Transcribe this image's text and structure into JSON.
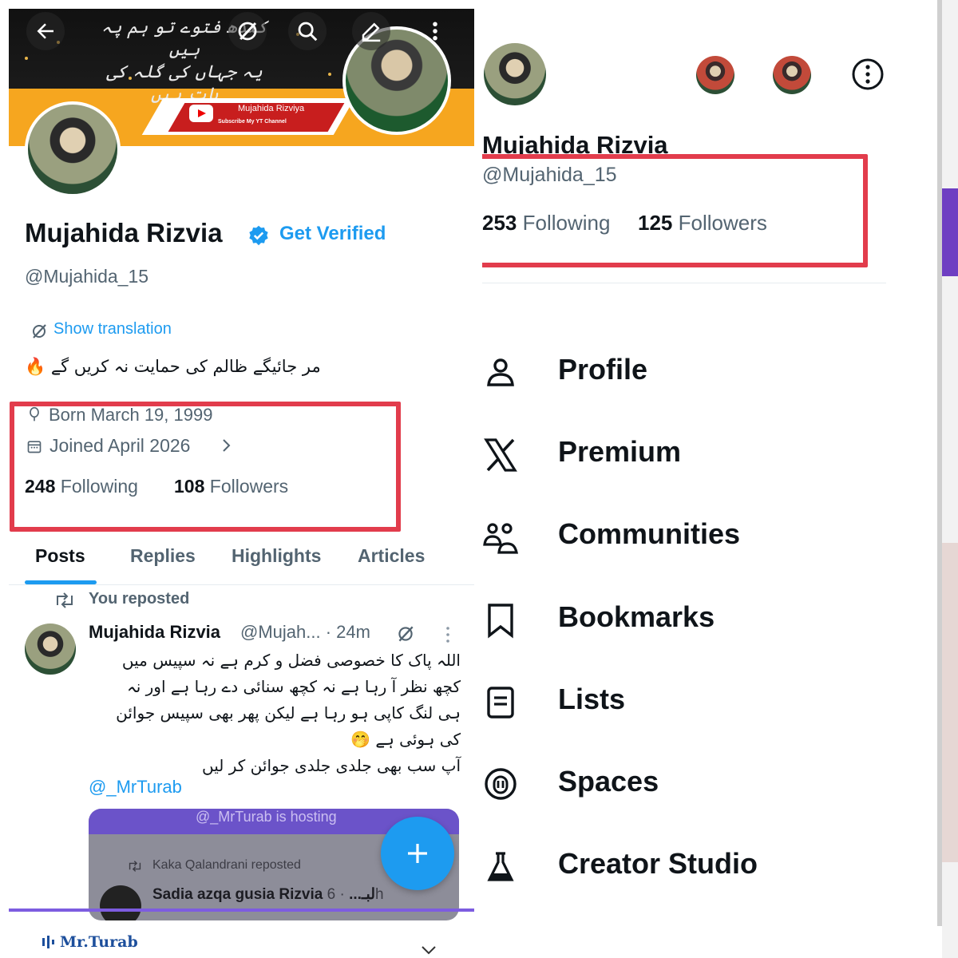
{
  "left": {
    "banner": {
      "calligraphy": [
        "کندھ فتوے تو ہم پہ ہیں",
        "یہ جہاں کی گلہ کی بات ہیں"
      ],
      "channel_name": "Mujahida Rizviya",
      "subscribe_text": "Subscribe My YT Channel"
    },
    "profile": {
      "name": "Mujahida Rizvia",
      "get_verified": "Get Verified",
      "handle": "@Mujahida_15",
      "show_translation": "Show translation",
      "bio": "مر جائیگے ظالم کی حمایت نہ کریں گے 🔥",
      "born": "Born March 19, 1999",
      "joined": "Joined April 2026",
      "following_count": "248",
      "following_label": "Following",
      "followers_count": "108",
      "followers_label": "Followers"
    },
    "tabs": [
      "Posts",
      "Replies",
      "Highlights",
      "Articles"
    ],
    "post": {
      "reposted_label": "You reposted",
      "author_name": "Mujahida Rizvia",
      "author_handle": "@Mujah...",
      "time": "· 24m",
      "text_lines": [
        "اللہ پاک کا خصوصی فضل و کرم ہے نہ سپیس میں",
        "کچھ نظر آ رہا ہے نہ کچھ سنائی دے رہا ہے اور نہ",
        "ہی لنگ کاپی ہو رہا ہے لیکن پھر بھی سپیس جوائن",
        "کی ہوئی ہے 🤭",
        "آپ سب بھی جلدی جلدی جوائن کر لیں"
      ],
      "mention": "@_MrTurab",
      "embed": {
        "hosting": "@_MrTurab is hosting",
        "reposted": "Kaka Qalandrani reposted",
        "author": "Sadia azqa gusia Rizvia لبـ...",
        "time": "· 6h"
      }
    },
    "footer_logo": "Mr.Turab"
  },
  "right": {
    "name": "Mujahida Rizvia",
    "handle": "@Mujahida_15",
    "following_count": "253",
    "following_label": "Following",
    "followers_count": "125",
    "followers_label": "Followers",
    "menu": [
      {
        "label": "Profile",
        "icon": "person-icon"
      },
      {
        "label": "Premium",
        "icon": "x-logo-icon"
      },
      {
        "label": "Communities",
        "icon": "communities-icon"
      },
      {
        "label": "Bookmarks",
        "icon": "bookmark-icon"
      },
      {
        "label": "Lists",
        "icon": "list-icon"
      },
      {
        "label": "Spaces",
        "icon": "spaces-icon"
      },
      {
        "label": "Creator Studio",
        "icon": "flask-icon"
      }
    ]
  },
  "colors": {
    "accent": "#1d9bf0",
    "highlight_box": "#e23c4c",
    "text_primary": "#0f1419",
    "text_secondary": "#536471"
  }
}
